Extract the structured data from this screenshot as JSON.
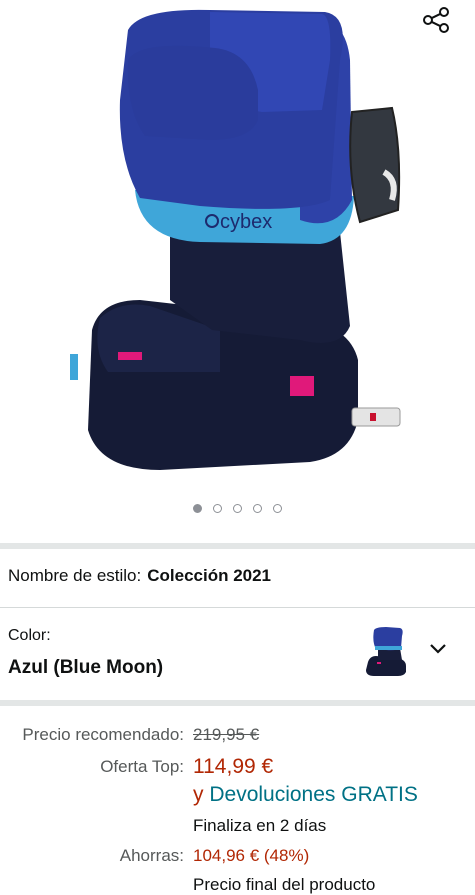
{
  "gallery": {
    "image_alt": "Cybex car seat",
    "seat_logo": "cybex",
    "share_icon": "share-icon",
    "dots_total": 5,
    "active_dot": 1
  },
  "style": {
    "label": "Nombre de estilo:",
    "value": "Colección 2021"
  },
  "color": {
    "label": "Color:",
    "value": "Azul (Blue Moon)",
    "dropdown_icon": "chevron-down-icon"
  },
  "pricing": {
    "recommended_label": "Precio recomendado:",
    "recommended_value": "219,95 €",
    "offer_label": "Oferta Top:",
    "offer_value": "114,99 €",
    "returns_prefix": "y",
    "returns_text": "Devoluciones GRATIS",
    "ends_text": "Finaliza en 2 días",
    "savings_label": "Ahorras:",
    "savings_value": "104,96 € (48%)",
    "final_text": "Precio final del producto"
  },
  "colors": {
    "price_red": "#b12704",
    "link_teal": "#007185",
    "seat_blue": "#2b3ea0",
    "seat_cyan": "#3fa6d9",
    "seat_navy": "#141a36"
  }
}
